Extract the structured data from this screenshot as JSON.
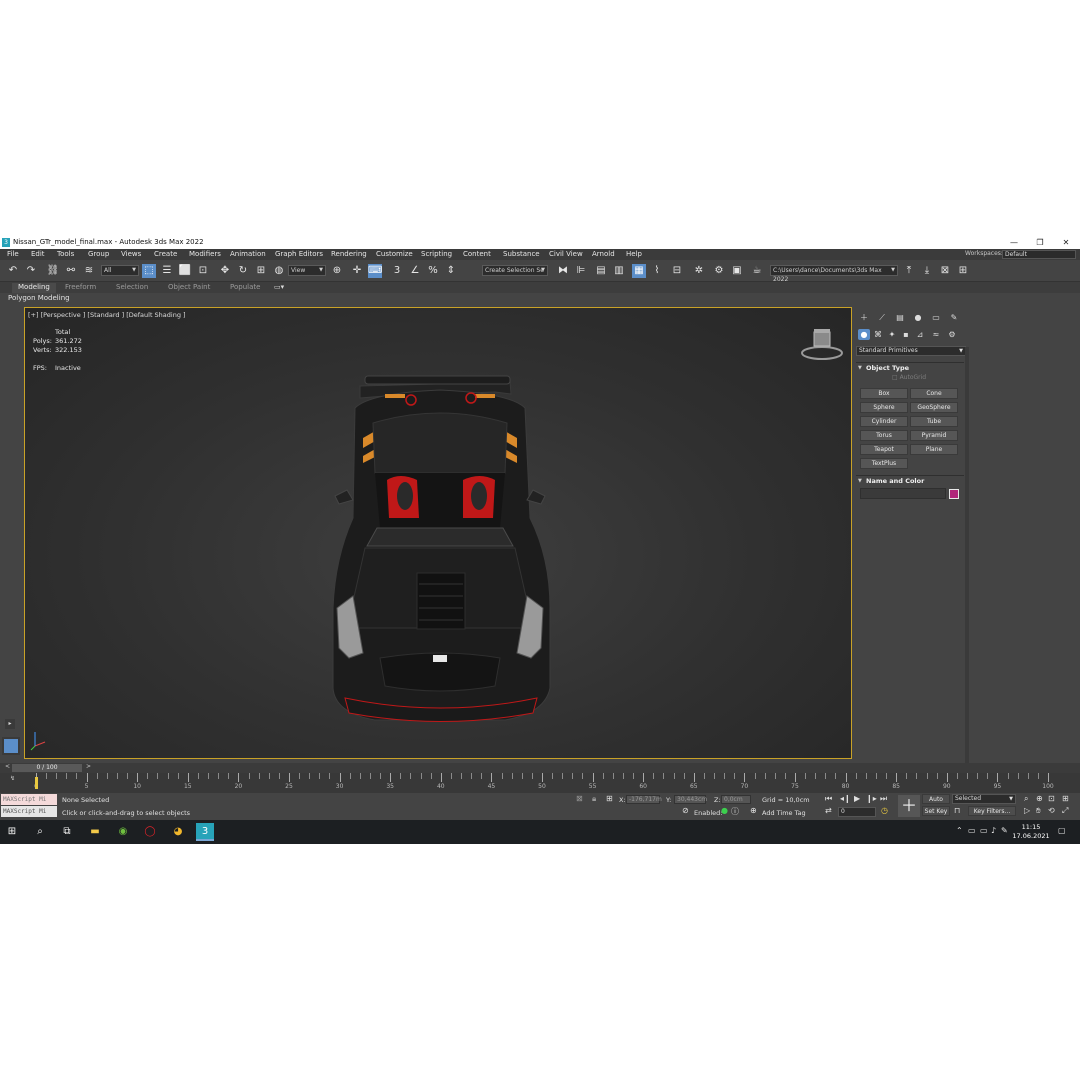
{
  "window": {
    "title": "Nissan_GTr_model_final.max - Autodesk 3ds Max 2022",
    "app_icon": "3",
    "controls": [
      "—",
      "❐",
      "✕"
    ]
  },
  "menu": {
    "items": [
      "File",
      "Edit",
      "Tools",
      "Group",
      "Views",
      "Create",
      "Modifiers",
      "Animation",
      "Graph Editors",
      "Rendering",
      "Customize",
      "Scripting",
      "Content",
      "Substance",
      "Civil View",
      "Arnold",
      "Help"
    ],
    "workspaces_label": "Workspaces:",
    "workspaces_value": "Default"
  },
  "toolbar": {
    "filter_value": "All",
    "refcoord_value": "View",
    "selection_set_placeholder": "Create Selection Se",
    "project_path": "C:\\Users\\dance\\Documents\\3ds Max 2022"
  },
  "ribbon": {
    "tabs": [
      "Modeling",
      "Freeform",
      "Selection",
      "Object Paint",
      "Populate"
    ],
    "active_tab": "Modeling",
    "panel_title": "Polygon Modeling"
  },
  "viewport": {
    "label": "[+] [Perspective ] [Standard ] [Default Shading ]",
    "stats": {
      "header": "Total",
      "polys_label": "Polys:",
      "polys_value": "361.272",
      "verts_label": "Verts:",
      "verts_value": "322.153",
      "fps_label": "FPS:",
      "fps_value": "Inactive"
    },
    "car_colors": {
      "body": "#1c1c1c",
      "interior": "#c01818",
      "stripe": "#d9892a"
    }
  },
  "command_panel": {
    "category_value": "Standard Primitives",
    "object_type_title": "Object Type",
    "autogrid_label": "AutoGrid",
    "buttons": [
      "Box",
      "Cone",
      "Sphere",
      "GeoSphere",
      "Cylinder",
      "Tube",
      "Torus",
      "Pyramid",
      "Teapot",
      "Plane",
      "TextPlus"
    ],
    "name_color_title": "Name and Color",
    "object_color": "#b0267a"
  },
  "timeline": {
    "slider_label": "0 / 100",
    "prev_icon": "<",
    "next_icon": ">",
    "tick_labels": [
      "0",
      "5",
      "10",
      "15",
      "20",
      "25",
      "30",
      "35",
      "40",
      "45",
      "50",
      "55",
      "60",
      "65",
      "70",
      "75",
      "80",
      "85",
      "90",
      "95",
      "100"
    ]
  },
  "status": {
    "maxscript_label": "MAXScript Mi",
    "selection_text": "None Selected",
    "prompt_text": "Click or click-and-drag to select objects",
    "x_label": "X:",
    "x_value": "-176,717m",
    "y_label": "Y:",
    "y_value": "30,443cm",
    "z_label": "Z:",
    "z_value": "0,0cm",
    "grid_text": "Grid = 10,0cm",
    "enabled_label": "Enabled:",
    "add_time_tag": "Add Time Tag",
    "auto_key": "Auto Key",
    "set_key": "Set Key",
    "key_filter_value": "Selected",
    "key_filters": "Key Filters...",
    "current_frame": "0"
  },
  "taskbar": {
    "time": "11:15",
    "date": "17.06.2021"
  }
}
